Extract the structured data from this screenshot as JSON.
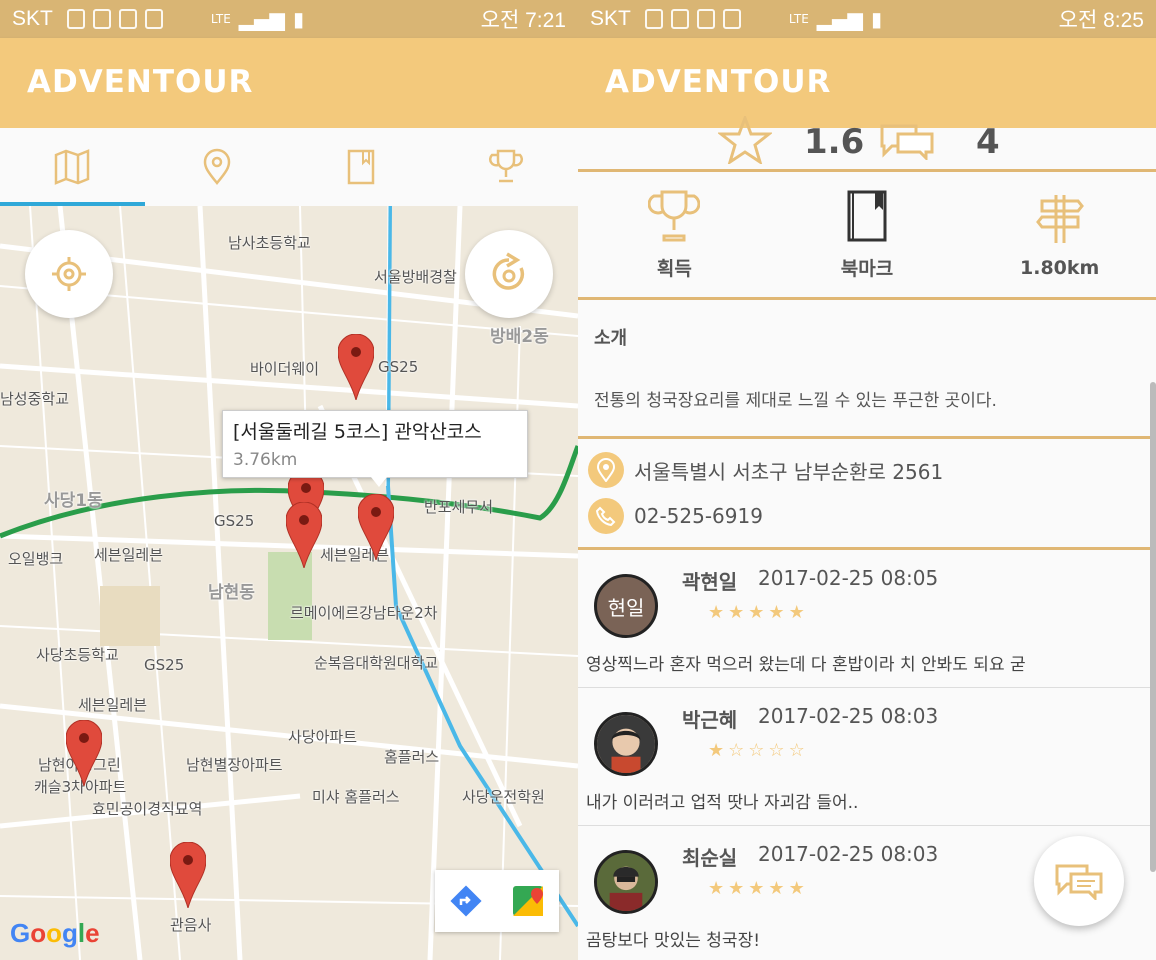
{
  "left": {
    "status": {
      "carrier": "SKT",
      "time": "오전 7:21",
      "network": "LTE"
    },
    "app_title": "ADVENTOUR",
    "tabs": [
      "map-tab",
      "location-tab",
      "bookmark-tab",
      "trophy-tab"
    ],
    "map": {
      "labels": [
        "남사초등학교",
        "서울방배경찰",
        "방배2동",
        "바이더웨이",
        "GS25",
        "남성중학교",
        "사당1동",
        "GS25",
        "반포세무서",
        "오일뱅크",
        "세븐일레븐",
        "세븐일레븐",
        "남현동",
        "르메이에르강남타운2차",
        "사당초등학교",
        "GS25",
        "순복음대학원대학교",
        "세븐일레븐",
        "사당아파트",
        "홈플러스",
        "남현아성그린",
        "캐슬3차아파트",
        "남현별장아파트",
        "미샤 홈플러스",
        "사당운전학원",
        "효민공이경직묘역",
        "관음사"
      ],
      "info_title": "[서울둘레길 5코스] 관악산코스",
      "info_distance": "3.76km",
      "google": "Google"
    }
  },
  "right": {
    "status": {
      "carrier": "SKT",
      "time": "오전 8:25",
      "network": "LTE"
    },
    "app_title": "ADVENTOUR",
    "rating": "1.6",
    "comment_count": "4",
    "infobar": {
      "acquire": "획득",
      "bookmark": "북마크",
      "distance": "1.80km"
    },
    "intro_title": "소개",
    "intro_text": "전통의 청국장요리를 제대로 느낄 수 있는 푸근한 곳이다.",
    "address": "서울특별시 서초구 남부순환로 2561",
    "phone": "02-525-6919",
    "reviews": [
      {
        "name": "곽현일",
        "date": "2017-02-25 08:05",
        "stars": 5,
        "avatar_text": "현일",
        "body": "영상찍느라 혼자 먹으러 왔는데 다 혼밥이라    치 안봐도 되요 굳"
      },
      {
        "name": "박근혜",
        "date": "2017-02-25 08:03",
        "stars": 1,
        "avatar_text": "",
        "body": "내가 이러려고 업적 땃나 자괴감 들어.."
      },
      {
        "name": "최순실",
        "date": "2017-02-25 08:03",
        "stars": 5,
        "avatar_text": "",
        "body": "곰탕보다 맛있는 청국장!"
      }
    ]
  },
  "colors": {
    "accent": "#f3c97c",
    "status": "#d9b574",
    "star": "#f3c97c",
    "pin": "#e04a3c",
    "tab_indicator": "#2fa8d8"
  }
}
